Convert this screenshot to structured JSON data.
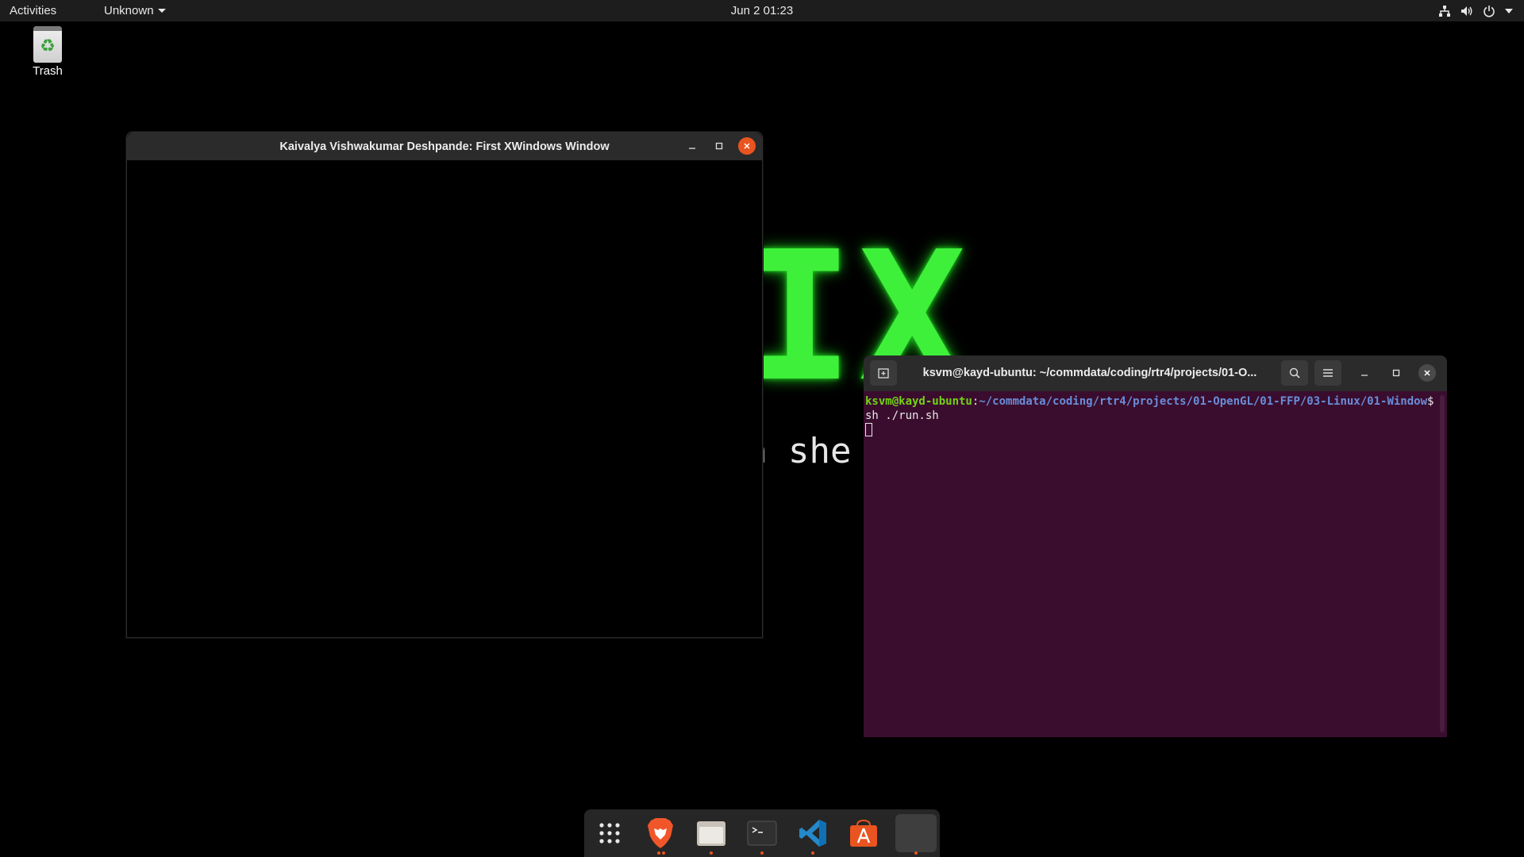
{
  "topbar": {
    "activities": "Activities",
    "app_menu": "Unknown",
    "clock": "Jun 2  01:23",
    "tray_icons": [
      "network-icon",
      "volume-icon",
      "power-icon",
      "chevron-down-icon"
    ]
  },
  "desktop": {
    "trash_label": "Trash",
    "wallpaper_big": "IX",
    "wallpaper_sub": "a she"
  },
  "xwindow": {
    "title": "Kaivalya Vishwakumar Deshpande: First XWindows Window"
  },
  "terminal": {
    "title": "ksvm@kayd-ubuntu: ~/commdata/coding/rtr4/projects/01-O...",
    "prompt_user": "ksvm@kayd-ubuntu",
    "prompt_sep": ":",
    "prompt_path": "~/commdata/coding/rtr4/projects/01-OpenGL/01-FFP/03-Linux/01-Window",
    "prompt_symbol": "$ ",
    "command": "sh ./run.sh",
    "colors": {
      "background": "#3a0d2e",
      "user": "#73d216",
      "path": "#6a8dd8"
    }
  },
  "dock": {
    "items": [
      {
        "name": "show-applications",
        "icon": "grid-icon",
        "running": false
      },
      {
        "name": "brave-browser",
        "icon": "lion-icon",
        "running": true
      },
      {
        "name": "files",
        "icon": "folder-icon",
        "running": true
      },
      {
        "name": "terminal",
        "icon": "terminal-icon",
        "running": true
      },
      {
        "name": "vscode",
        "icon": "vscode-icon",
        "running": true
      },
      {
        "name": "software-store",
        "icon": "store-icon",
        "running": false
      },
      {
        "name": "xwindow-app",
        "icon": "blank-window-icon",
        "running": true
      }
    ],
    "accent": "#e95420"
  }
}
